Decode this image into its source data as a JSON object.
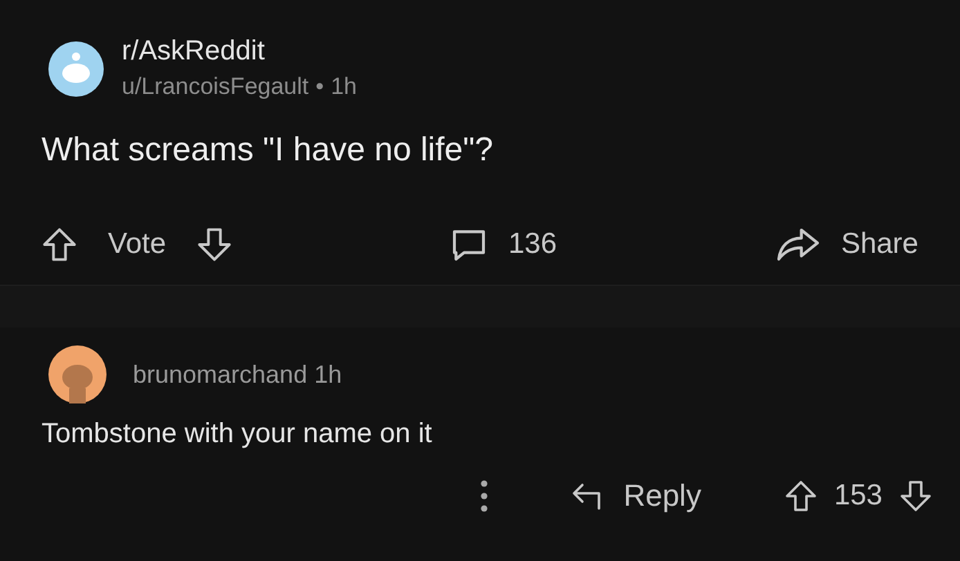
{
  "post": {
    "subreddit": "r/AskReddit",
    "author": "u/LrancoisFegault",
    "separator": "•",
    "age": "1h",
    "title": "What screams \"I have no life\"?",
    "vote_label": "Vote",
    "comment_count": "136",
    "share_label": "Share"
  },
  "comment": {
    "author": "brunomarchand",
    "age": "1h",
    "body": "Tombstone with your name on it",
    "reply_label": "Reply",
    "score": "153"
  }
}
